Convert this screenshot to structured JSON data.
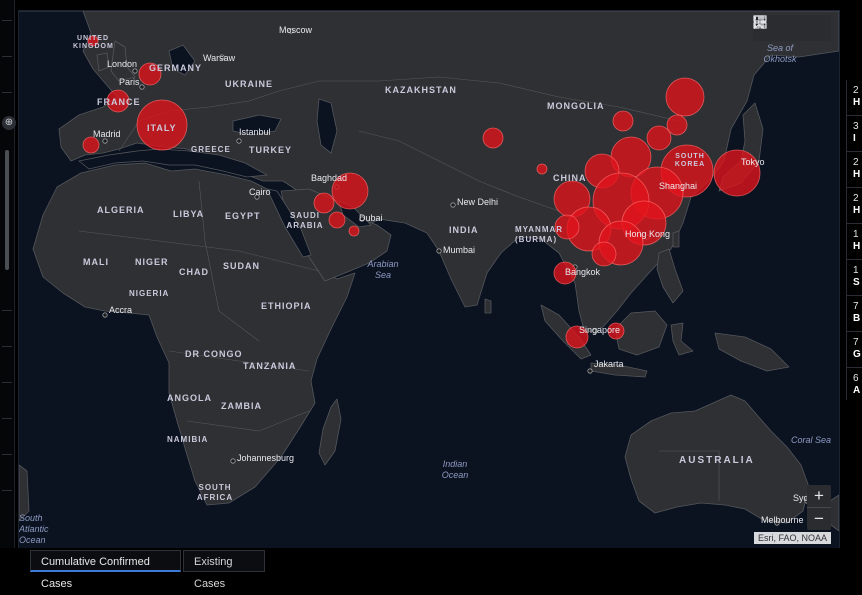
{
  "map": {
    "countries": [
      "UNITED KINGDOM",
      "FRANCE",
      "GERMANY",
      "ITALY",
      "UKRAINE",
      "GREECE",
      "TURKEY",
      "KAZAKHSTAN",
      "MONGOLIA",
      "CHINA",
      "SOUTH KOREA",
      "INDIA",
      "MYANMAR (BURMA)",
      "SAUDI ARABIA",
      "EGYPT",
      "LIBYA",
      "ALGERIA",
      "MALI",
      "NIGER",
      "CHAD",
      "SUDAN",
      "NIGERIA",
      "ETHIOPIA",
      "DR CONGO",
      "TANZANIA",
      "ANGOLA",
      "ZAMBIA",
      "NAMIBIA",
      "SOUTH AFRICA",
      "AUSTRALIA"
    ],
    "cities": [
      "Moscow",
      "Warsaw",
      "London",
      "Paris",
      "Madrid",
      "Istanbul",
      "Cairo",
      "Baghdad",
      "Dubai",
      "New Delhi",
      "Mumbai",
      "Tokyo",
      "Shanghai",
      "Hong Kong",
      "Bangkok",
      "Singapore",
      "Jakarta",
      "Accra",
      "Johannesburg",
      "Sydney",
      "Melbourne"
    ],
    "seas": [
      "Sea of Okhotsk",
      "Arabian Sea",
      "Indian Ocean",
      "Coral Sea",
      "South Atlantic Ocean"
    ],
    "attribution": "Esri, FAO, NOAA",
    "tools": [
      "bookmark-icon",
      "legend-icon",
      "basemap-gallery-icon"
    ],
    "zoom_in": "+",
    "zoom_out": "−",
    "case_bubble_color": "#ff0000"
  },
  "panel": {
    "rows": [
      {
        "n": "2",
        "c": "H"
      },
      {
        "n": "3",
        "c": "I"
      },
      {
        "n": "2",
        "c": "H"
      },
      {
        "n": "2",
        "c": "H"
      },
      {
        "n": "1",
        "c": "H"
      },
      {
        "n": "1",
        "c": "S"
      },
      {
        "n": "7",
        "c": "B"
      },
      {
        "n": "7",
        "c": "G"
      },
      {
        "n": "6",
        "c": "A"
      }
    ]
  },
  "tabs": {
    "cumulative": "Cumulative Confirmed Cases",
    "existing": "Existing Cases"
  },
  "sidebar": {
    "expand_icon": "⊕"
  }
}
